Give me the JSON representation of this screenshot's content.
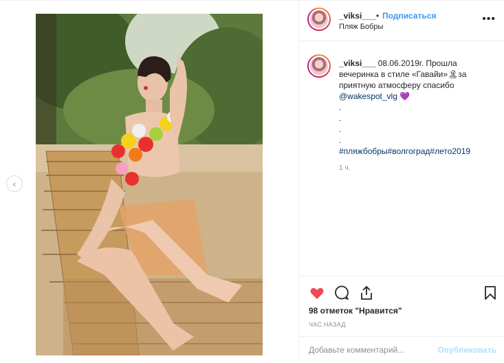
{
  "post": {
    "username": "_viksi___",
    "follow_label": "Подписаться",
    "separator": "•",
    "location": "Пляж Бобры",
    "more_label": "•••",
    "caption": {
      "username": "_viksi___",
      "text": "08.06.2019г. Прошла вечеринка в стиле «Гавайи»🏝за приятную атмосферу спасибо",
      "mention": "@wakespot_vlg",
      "heart": "💜",
      "dots": [
        ".",
        ".",
        ".",
        "."
      ],
      "hashtags": "#пляжбобры#волгоград#лето2019"
    },
    "relative_time": "1 ч.",
    "likes_text": "98 отметок \"Нравится\"",
    "time_ago": "ЧАС НАЗАД",
    "comment_placeholder": "Добавьте комментарий...",
    "publish_label": "Опубликовать",
    "prev_arrow": "‹"
  },
  "icons": {
    "like": "heart-icon",
    "comment": "comment-icon",
    "share": "share-icon",
    "save": "bookmark-icon"
  },
  "colors": {
    "accent": "#3897f0",
    "like_red": "#ed4956",
    "muted": "#8e8e8e",
    "publish_disabled": "#b2dffc"
  }
}
